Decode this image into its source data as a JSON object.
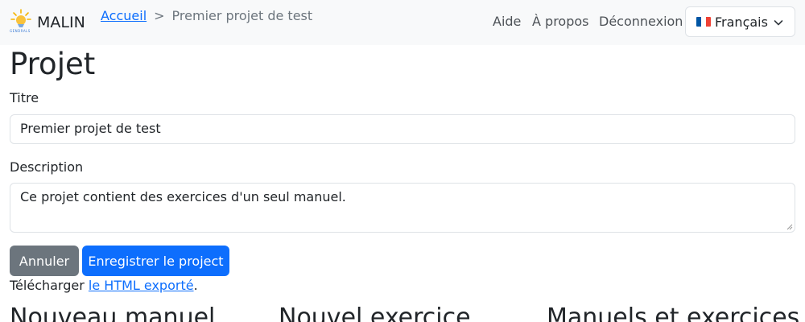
{
  "navbar": {
    "brand": "MALIN",
    "logo_text": "GENDRALS",
    "breadcrumb": {
      "home": "Accueil",
      "separator": ">",
      "current": "Premier projet de test"
    },
    "links": {
      "help": "Aide",
      "about": "À propos",
      "logout": "Déconnexion"
    },
    "language": "Français"
  },
  "page": {
    "title": "Projet"
  },
  "form": {
    "title_label": "Titre",
    "title_value": "Premier projet de test",
    "description_label": "Description",
    "description_value": "Ce projet contient des exercices d'un seul manuel.",
    "cancel_label": "Annuler",
    "save_label": "Enregistrer le project"
  },
  "download": {
    "prefix": "Télécharger",
    "link": "le HTML exporté",
    "suffix": "."
  },
  "sections": [
    "Nouveau manuel",
    "Nouvel exercice",
    "Manuels et exercices"
  ],
  "colors": {
    "primary": "#0d6efd",
    "secondary": "#6c757d",
    "navbar_bg": "#f8f9fa"
  }
}
